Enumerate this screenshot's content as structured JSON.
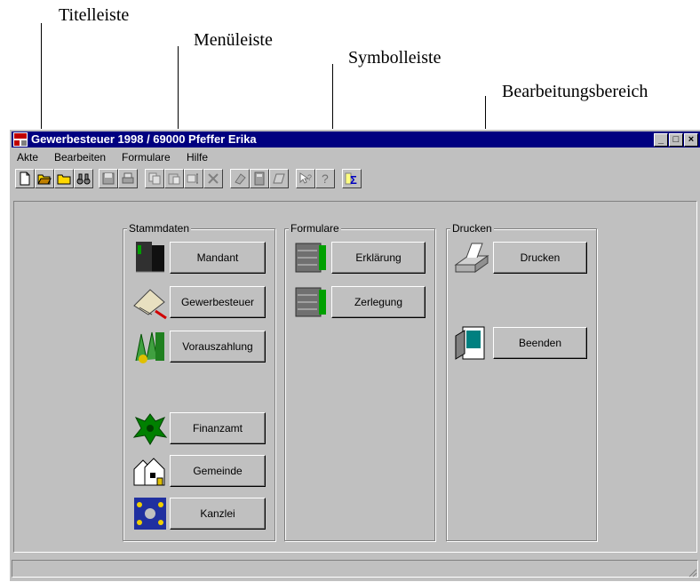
{
  "callouts": {
    "title_bar": "Titelleiste",
    "menu_bar": "Menüleiste",
    "toolbar": "Symbolleiste",
    "work_area": "Bearbeitungsbereich"
  },
  "window": {
    "title": "Gewerbesteuer 1998 / 69000 Pfeffer Erika",
    "controls": {
      "minimize": "_",
      "maximize": "□",
      "close": "×"
    }
  },
  "menu": [
    "Akte",
    "Bearbeiten",
    "Formulare",
    "Hilfe"
  ],
  "toolbar_icons": [
    "new-document-icon",
    "open-folder-icon",
    "folder-icon",
    "binoculars-icon",
    "save-icon",
    "print-icon",
    "copy-icon",
    "paste-icon",
    "insert-icon",
    "delete-icon",
    "stamp-icon",
    "calculator-icon",
    "notebook-icon",
    "whats-this-icon",
    "help-icon",
    "sum-icon"
  ],
  "groups": {
    "stammdaten": {
      "title": "Stammdaten",
      "buttons": [
        "Mandant",
        "Gewerbesteuer",
        "Vorauszahlung",
        "Finanzamt",
        "Gemeinde",
        "Kanzlei"
      ]
    },
    "formulare": {
      "title": "Formulare",
      "buttons": [
        "Erklärung",
        "Zerlegung"
      ]
    },
    "drucken": {
      "title": "Drucken",
      "buttons": [
        "Drucken",
        "Beenden"
      ]
    }
  },
  "colors": {
    "title_bar": "#000080",
    "face": "#c0c0c0"
  }
}
